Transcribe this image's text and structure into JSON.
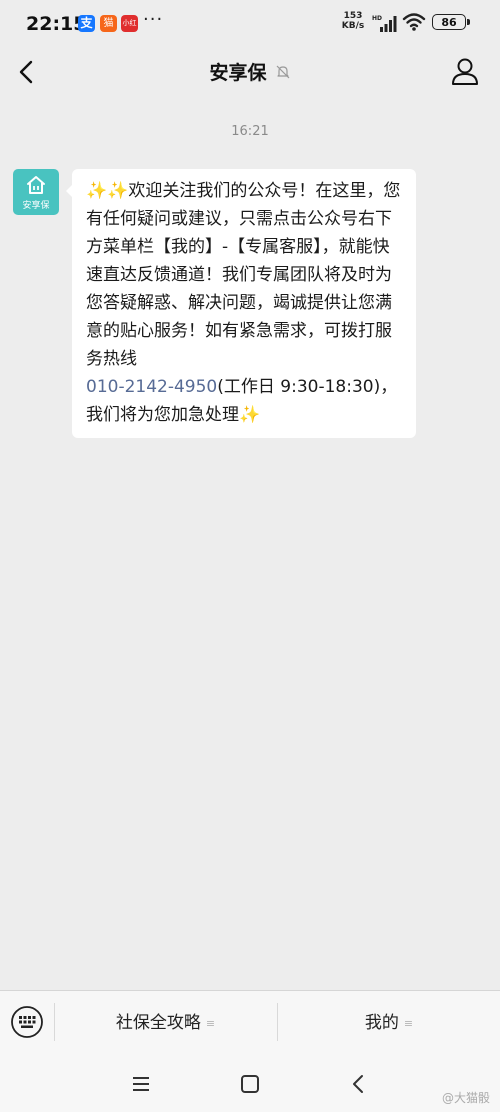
{
  "status_bar": {
    "time": "22:15",
    "apps": [
      "alipay",
      "tmall",
      "small-app"
    ],
    "more": "···",
    "net_speed_value": "153",
    "net_speed_unit": "KB/s",
    "signal_label": "HD",
    "battery": "86"
  },
  "nav": {
    "title": "安享保",
    "back_icon": "chevron-left-icon",
    "mute_icon": "bell-off-icon",
    "profile_icon": "person-icon"
  },
  "chat": {
    "timestamp": "16:21",
    "avatar_label": "安享保",
    "message": {
      "sparkles": "✨✨",
      "text_main": "欢迎关注我们的公众号！在这里，您有任何疑问或建议，只需点击公众号右下方菜单栏【我的】-【专属客服】，就能快速直达反馈通道！我们专属团队将及时为您答疑解惑、解决问题，竭诚提供让您满意的贴心服务！如有紧急需求，可拨打服务热线",
      "phone": "010-2142-4950",
      "text_hours": "(工作日 9:30-18:30)，我们将为您加急处理",
      "trailing_sparkle": "✨"
    }
  },
  "bottom_menu": {
    "keyboard_icon": "keyboard-icon",
    "items": [
      {
        "label": "社保全攻略",
        "lines": "≡"
      },
      {
        "label": "我的",
        "lines": "≡"
      }
    ]
  },
  "system_nav": {
    "menu_icon": "menu-icon",
    "home_icon": "home-icon",
    "back_icon": "back-icon",
    "watermark": "@大猫骰"
  }
}
